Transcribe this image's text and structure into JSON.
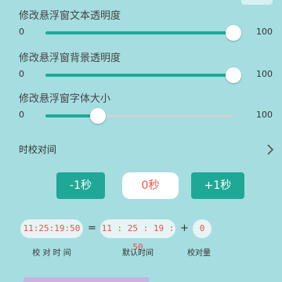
{
  "settings": {
    "text_opacity": {
      "label": "修改悬浮窗文本透明度",
      "min": "0",
      "max": "100",
      "value": 100
    },
    "bg_opacity": {
      "label": "修改悬浮窗背景透明度",
      "min": "0",
      "max": "100",
      "value": 100
    },
    "font_size": {
      "label": "修改悬浮窗字体大小",
      "min": "0",
      "max": "100",
      "value": 28
    }
  },
  "calibrate": {
    "label": "时校对间",
    "chevron_icon": "chevron-right-icon"
  },
  "buttons": {
    "minus": "-1秒",
    "zero": "0秒",
    "plus": "+1秒"
  },
  "times": {
    "calibrated": "11:25:19:50",
    "equals": "=",
    "default": "11 : 25 : 19 : 50",
    "plus_sign": "+",
    "offset": "0"
  },
  "captions": {
    "calibrated": "校 对 时 间",
    "default": "默认时间",
    "offset": "校对量"
  },
  "colors": {
    "background": "#a6dde0",
    "accent": "#1fa896",
    "warning_text": "#e8524a"
  }
}
